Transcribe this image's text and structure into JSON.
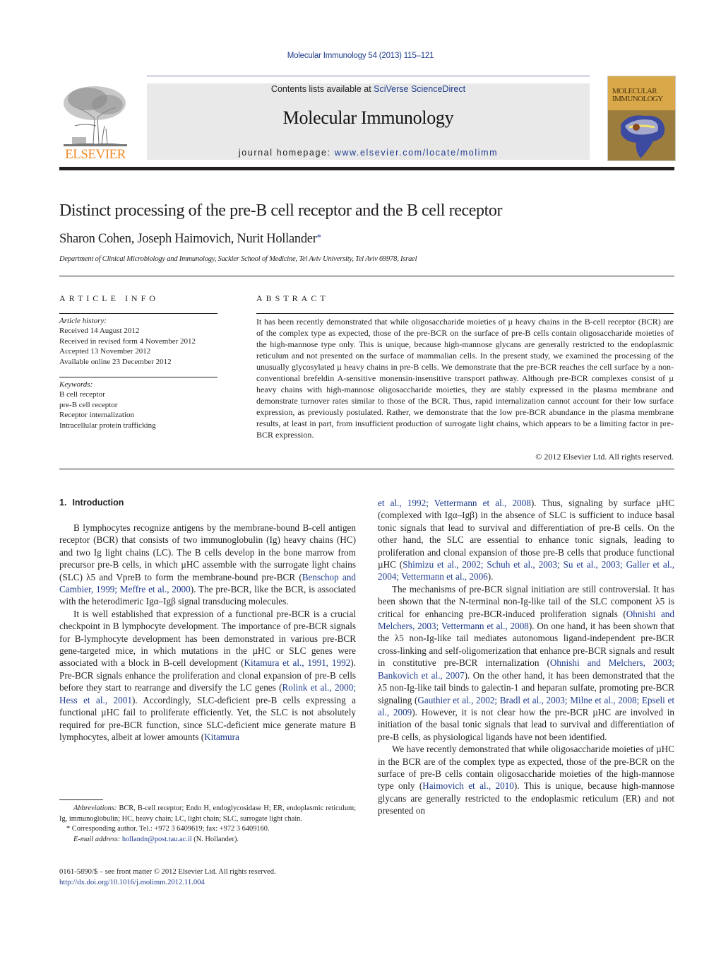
{
  "header": {
    "running_head": "Molecular Immunology 54 (2013) 115–121",
    "contents_prefix": "Contents lists available at ",
    "contents_link": "SciVerse ScienceDirect",
    "journal_name": "Molecular Immunology",
    "homepage_prefix": "journal homepage: ",
    "homepage_link": "www.elsevier.com/locate/molimm",
    "publisher_wordmark": "ELSEVIER",
    "cover_title_line1": "MOLECULAR",
    "cover_title_line2": "IMMUNOLOGY",
    "colors": {
      "link": "#1e3c8c",
      "elsevier_orange": "#f08a24",
      "masthead_bg": "#e9e9ea",
      "cover_gold": "#d9a849"
    }
  },
  "article": {
    "title": "Distinct processing of the pre-B cell receptor and the B cell receptor",
    "authors": "Sharon Cohen, Joseph Haimovich, Nurit Hollander",
    "corresponding_mark": "*",
    "affiliation": "Department of Clinical Microbiology and Immunology, Sackler School of Medicine, Tel Aviv University, Tel Aviv 69978, Israel"
  },
  "article_info": {
    "heading": "ARTICLE INFO",
    "history_label": "Article history:",
    "history": [
      "Received 14 August 2012",
      "Received in revised form 4 November 2012",
      "Accepted 13 November 2012",
      "Available online 23 December 2012"
    ],
    "keywords_label": "Keywords:",
    "keywords": [
      "B cell receptor",
      "pre-B cell receptor",
      "Receptor internalization",
      "Intracellular protein trafficking"
    ]
  },
  "abstract": {
    "heading": "ABSTRACT",
    "text": "It has been recently demonstrated that while oligosaccharide moieties of µ heavy chains in the B-cell receptor (BCR) are of the complex type as expected, those of the pre-BCR on the surface of pre-B cells contain oligosaccharide moieties of the high-mannose type only. This is unique, because high-mannose glycans are generally restricted to the endoplasmic reticulum and not presented on the surface of mammalian cells. In the present study, we examined the processing of the unusually glycosylated µ heavy chains in pre-B cells. We demonstrate that the pre-BCR reaches the cell surface by a non-conventional brefeldin A-sensitive monensin-insensitive transport pathway. Although pre-BCR complexes consist of µ heavy chains with high-mannose oligosaccharide moieties, they are stably expressed in the plasma membrane and demonstrate turnover rates similar to those of the BCR. Thus, rapid internalization cannot account for their low surface expression, as previously postulated. Rather, we demonstrate that the low pre-BCR abundance in the plasma membrane results, at least in part, from insufficient production of surrogate light chains, which appears to be a limiting factor in pre-BCR expression.",
    "copyright": "© 2012 Elsevier Ltd. All rights reserved."
  },
  "body": {
    "section_number": "1.",
    "section_title": "Introduction",
    "left_column": [
      [
        {
          "t": "B lymphocytes recognize antigens by the membrane-bound B-cell antigen receptor (BCR) that consists of two immunoglobulin (Ig) heavy chains (HC) and two Ig light chains (LC). The B cells develop in the bone marrow from precursor pre-B cells, in which µHC assemble with the surrogate light chains (SLC) λ5 and VpreB to form the membrane-bound pre-BCR ("
        },
        {
          "t": "Benschop and Cambier, 1999; Meffre et al., 2000",
          "link": true
        },
        {
          "t": "). The pre-BCR, like the BCR, is associated with the heterodimeric Igα–Igβ signal transducing molecules."
        }
      ],
      [
        {
          "t": "It is well established that expression of a functional pre-BCR is a crucial checkpoint in B lymphocyte development. The importance of pre-BCR signals for B-lymphocyte development has been demonstrated in various pre-BCR gene-targeted mice, in which mutations in the µHC or SLC genes were associated with a block in B-cell development ("
        },
        {
          "t": "Kitamura et al., 1991, 1992",
          "link": true
        },
        {
          "t": "). Pre-BCR signals enhance the proliferation and clonal expansion of pre-B cells before they start to rearrange and diversify the LC genes ("
        },
        {
          "t": "Rolink et al., 2000; Hess et al., 2001",
          "link": true
        },
        {
          "t": "). Accordingly, SLC-deficient pre-B cells expressing a functional µHC fail to proliferate efficiently. Yet, the SLC is not absolutely required for pre-BCR function, since SLC-deficient mice generate mature B lymphocytes, albeit at lower amounts ("
        },
        {
          "t": "Kitamura",
          "link": true
        }
      ]
    ],
    "right_column": [
      [
        {
          "t": "et al., 1992; Vettermann et al., 2008",
          "link": true
        },
        {
          "t": "). Thus, signaling by surface µHC (complexed with Igα–Igβ) in the absence of SLC is sufficient to induce basal tonic signals that lead to survival and differentiation of pre-B cells. On the other hand, the SLC are essential to enhance tonic signals, leading to proliferation and clonal expansion of those pre-B cells that produce functional µHC ("
        },
        {
          "t": "Shimizu et al., 2002; Schuh et al., 2003; Su et al., 2003; Galler et al., 2004; Vettermann et al., 2006",
          "link": true
        },
        {
          "t": ")."
        }
      ],
      [
        {
          "t": "The mechanisms of pre-BCR signal initiation are still controversial. It has been shown that the N-terminal non-Ig-like tail of the SLC component λ5 is critical for enhancing pre-BCR-induced proliferation signals ("
        },
        {
          "t": "Ohnishi and Melchers, 2003; Vettermann et al., 2008",
          "link": true
        },
        {
          "t": "). On one hand, it has been shown that the λ5 non-Ig-like tail mediates autonomous ligand-independent pre-BCR cross-linking and self-oligomerization that enhance pre-BCR signals and result in constitutive pre-BCR internalization ("
        },
        {
          "t": "Ohnishi and Melchers, 2003; Bankovich et al., 2007",
          "link": true
        },
        {
          "t": "). On the other hand, it has been demonstrated that the λ5 non-Ig-like tail binds to galectin-1 and heparan sulfate, promoting pre-BCR signaling ("
        },
        {
          "t": "Gauthier et al., 2002; Bradl et al., 2003; Milne et al., 2008; Epseli et al., 2009",
          "link": true
        },
        {
          "t": "). However, it is not clear how the pre-BCR µHC are involved in initiation of the basal tonic signals that lead to survival and differentiation of pre-B cells, as physiological ligands have not been identified."
        }
      ],
      [
        {
          "t": "We have recently demonstrated that while oligosaccharide moieties of µHC in the BCR are of the complex type as expected, those of the pre-BCR on the surface of pre-B cells contain oligosaccharide moieties of the high-mannose type only ("
        },
        {
          "t": "Haimovich et al., 2010",
          "link": true
        },
        {
          "t": "). This is unique, because high-mannose glycans are generally restricted to the endoplasmic reticulum (ER) and not presented on"
        }
      ]
    ]
  },
  "footnotes": {
    "abbreviations_label": "Abbreviations:",
    "abbreviations_text": " BCR, B-cell receptor; Endo H, endoglycosidase H; ER, endoplasmic reticulum; Ig, immunoglobulin; HC, heavy chain; LC, light chain; SLC, surrogate light chain.",
    "corresponding_mark": "*",
    "corresponding_text": " Corresponding author. Tel.: +972 3 6409619; fax: +972 3 6409160.",
    "email_label": "E-mail address:",
    "email": "hollandn@post.tau.ac.il",
    "email_suffix": " (N. Hollander)."
  },
  "imprint": {
    "issn_line": "0161-5890/$ – see front matter © 2012 Elsevier Ltd. All rights reserved.",
    "doi": "http://dx.doi.org/10.1016/j.molimm.2012.11.004"
  }
}
